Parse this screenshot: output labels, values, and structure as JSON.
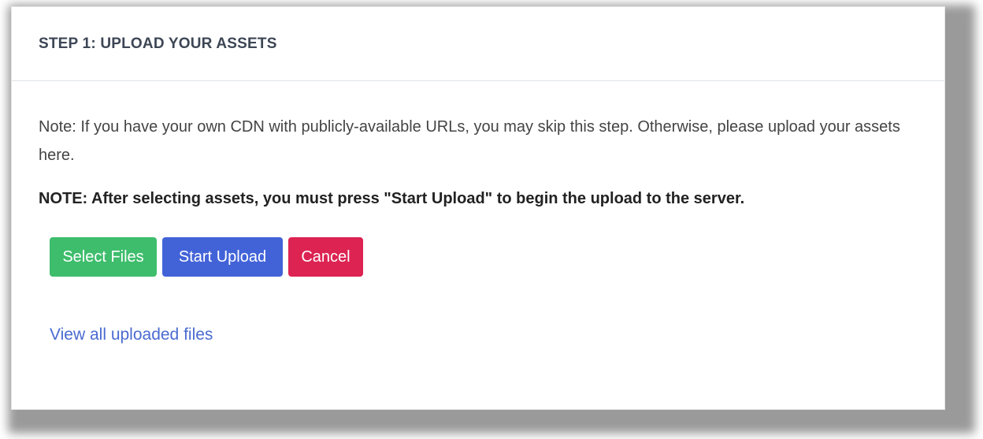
{
  "card": {
    "title": "STEP 1: UPLOAD YOUR ASSETS",
    "note": "Note: If you have your own CDN with publicly-available URLs, you may skip this step. Otherwise, please upload your assets here.",
    "note_strong": "NOTE: After selecting assets, you must press \"Start Upload\" to begin the upload to the server."
  },
  "buttons": {
    "select_files": "Select Files",
    "start_upload": "Start Upload",
    "cancel": "Cancel"
  },
  "links": {
    "view_all": "View all uploaded files"
  },
  "colors": {
    "select_files": "#3ebd6c",
    "start_upload": "#4263d8",
    "cancel": "#dc2352",
    "link": "#4a6bd0"
  }
}
